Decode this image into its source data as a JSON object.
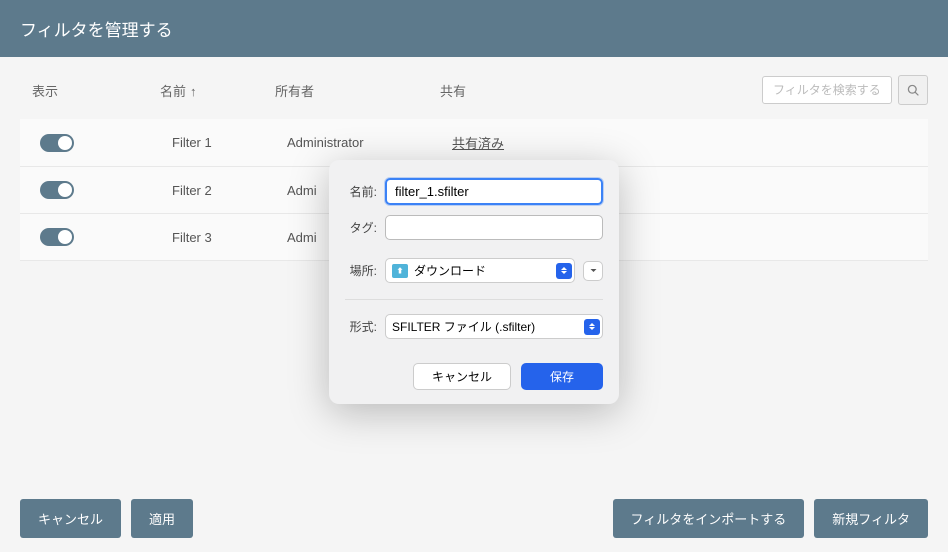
{
  "header": {
    "title": "フィルタを管理する"
  },
  "columns": {
    "show": "表示",
    "name": "名前",
    "owner": "所有者",
    "share": "共有"
  },
  "search": {
    "placeholder": "フィルタを検索する..."
  },
  "rows": [
    {
      "name": "Filter 1",
      "owner": "Administrator",
      "share": "共有済み"
    },
    {
      "name": "Filter 2",
      "owner": "Admi"
    },
    {
      "name": "Filter 3",
      "owner": "Admi"
    }
  ],
  "footer": {
    "cancel": "キャンセル",
    "apply": "適用",
    "import": "フィルタをインポートする",
    "new": "新規フィルタ"
  },
  "modal": {
    "labels": {
      "name": "名前:",
      "tags": "タグ:",
      "location": "場所:",
      "format": "形式:"
    },
    "filename": "filter_1.sfilter",
    "tags": "",
    "location": "ダウンロード",
    "format": "SFILTER ファイル (.sfilter)",
    "cancel": "キャンセル",
    "save": "保存"
  }
}
